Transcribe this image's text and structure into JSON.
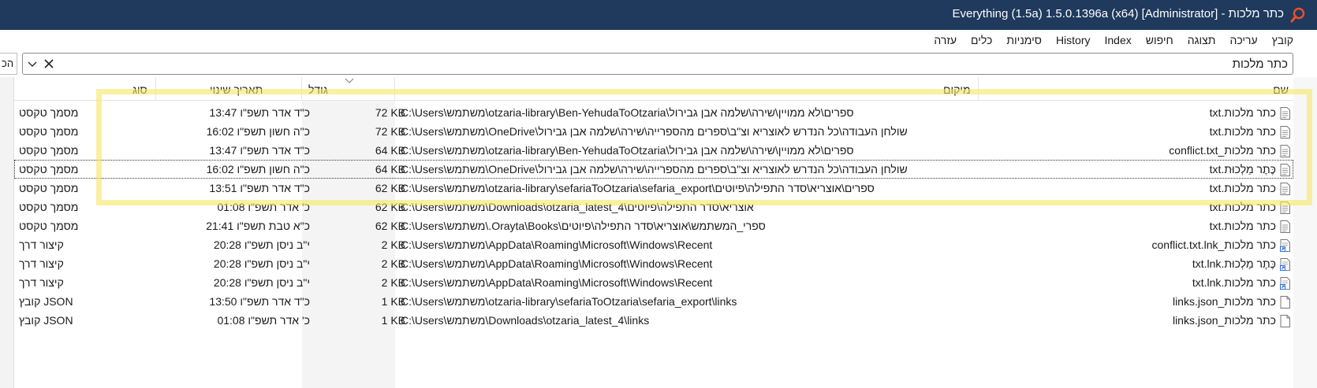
{
  "window": {
    "title": "כתר מלכות - Everything (1.5a) 1.5.0.1396a (x64) [Administrator]"
  },
  "menu": {
    "items": [
      "קובץ",
      "עריכה",
      "תצוגה",
      "חיפוש",
      "Index",
      "History",
      "סימניות",
      "כלים",
      "עזרה"
    ]
  },
  "left_stub_label": "הכ",
  "search": {
    "value": "כתר מלכות"
  },
  "columns": {
    "name": "שם",
    "path": "מיקום",
    "size": "גודל",
    "date": "תאריך שינוי",
    "type": "סוג"
  },
  "rows": [
    {
      "name": "כתר מלכות.txt",
      "path": "C:\\Users\\משתמש\\otzaria-library\\Ben-YehudaToOtzaria\\ספרים\\לא ממויין\\שירה\\שלמה אבן גבירול",
      "size": "72 KB",
      "date": "כ\"ד אדר תשפ\"ו 13:47",
      "type": "מסמך טקסט",
      "icon": "text-file-icon"
    },
    {
      "name": "כתר מלכות.txt",
      "path": "C:\\Users\\משתמש\\OneDrive\\שולחן העבודה\\כל הנדרש לאוצריא וצ\"ב\\ספרים מהספרייה\\שירה\\שלמה אבן גבירול",
      "size": "72 KB",
      "date": "כ\"ה חשון תשפ\"ו 16:02",
      "type": "מסמך טקסט",
      "icon": "text-file-icon"
    },
    {
      "name": "כתר מלכות_conflict.txt",
      "path": "C:\\Users\\משתמש\\otzaria-library\\Ben-YehudaToOtzaria\\ספרים\\לא ממויין\\שירה\\שלמה אבן גבירול",
      "size": "64 KB",
      "date": "כ\"ד אדר תשפ\"ו 13:47",
      "type": "מסמך טקסט",
      "icon": "text-file-icon"
    },
    {
      "name": "כֶּתֶר מַלְכוּת.txt",
      "path": "C:\\Users\\משתמש\\OneDrive\\שולחן העבודה\\כל הנדרש לאוצריא וצ\"ב\\ספרים מהספרייה\\שירה\\שלמה אבן גבירול",
      "size": "64 KB",
      "date": "כ\"ה חשון תשפ\"ו 16:02",
      "type": "מסמך טקסט",
      "icon": "text-file-icon"
    },
    {
      "name": "כתר מלכות.txt",
      "path": "C:\\Users\\משתמש\\otzaria-library\\sefariaToOtzaria\\sefaria_export\\ספרים\\אוצריא\\סדר התפילה\\פיוטים",
      "size": "62 KB",
      "date": "כ\"ד אדר תשפ\"ו 13:51",
      "type": "מסמך טקסט",
      "icon": "text-file-icon"
    },
    {
      "name": "כתר מלכות.txt",
      "path": "C:\\Users\\משתמש\\Downloads\\otzaria_latest_4\\אוצריא\\סדר התפילה\\פיוטים",
      "size": "62 KB",
      "date": "כ' אדר תשפ\"ו 01:08",
      "type": "מסמך טקסט",
      "icon": "text-file-icon"
    },
    {
      "name": "כתר מלכות.txt",
      "path": "C:\\Users\\משתמש\\.Orayta\\Books\\ספרי_המשתמש\\אוצריא\\סדר התפילה\\פיוטים",
      "size": "62 KB",
      "date": "כ\"א טבת תשפ\"ו 21:41",
      "type": "מסמך טקסט",
      "icon": "text-file-icon"
    },
    {
      "name": "כתר מלכות_conflict.txt.lnk",
      "path": "C:\\Users\\משתמש\\AppData\\Roaming\\Microsoft\\Windows\\Recent",
      "size": "2 KB",
      "date": "י\"ב ניסן תשפ\"ו 20:28",
      "type": "קיצור דרך",
      "icon": "shortcut-icon"
    },
    {
      "name": "כֶּתֶר מַלְכוּת.txt.lnk",
      "path": "C:\\Users\\משתמש\\AppData\\Roaming\\Microsoft\\Windows\\Recent",
      "size": "2 KB",
      "date": "י\"ב ניסן תשפ\"ו 20:28",
      "type": "קיצור דרך",
      "icon": "shortcut-icon"
    },
    {
      "name": "כתר מלכות.txt.lnk",
      "path": "C:\\Users\\משתמש\\AppData\\Roaming\\Microsoft\\Windows\\Recent",
      "size": "2 KB",
      "date": "י\"ב ניסן תשפ\"ו 20:28",
      "type": "קיצור דרך",
      "icon": "shortcut-icon"
    },
    {
      "name": "כתר מלכות_links.json",
      "path": "C:\\Users\\משתמש\\otzaria-library\\sefariaToOtzaria\\sefaria_export\\links",
      "size": "1 KB",
      "date": "כ\"ד אדר תשפ\"ו 13:50",
      "type": "קובץ JSON",
      "icon": "json-file-icon"
    },
    {
      "name": "כתר מלכות_links.json",
      "path": "C:\\Users\\משתמש\\Downloads\\otzaria_latest_4\\links",
      "size": "1 KB",
      "date": "כ' אדר תשפ\"ו 01:08",
      "type": "קובץ JSON",
      "icon": "json-file-icon"
    }
  ],
  "colors": {
    "titlebar": "#1f3a5c",
    "highlight": "#f5e664",
    "size_column_band": "#f4f4f4"
  }
}
